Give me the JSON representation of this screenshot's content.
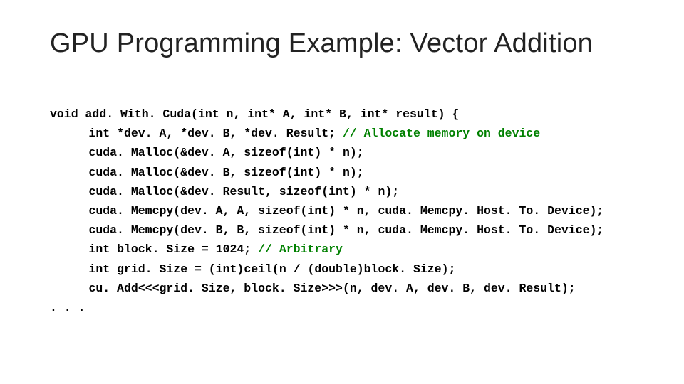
{
  "title": "GPU Programming Example: Vector Addition",
  "code": {
    "l1_a": "void",
    "l1_b": " add. With. Cuda(",
    "l1_c": "int",
    "l1_d": " n, ",
    "l1_e": "int*",
    "l1_f": " A, ",
    "l1_g": "int*",
    "l1_h": " B, ",
    "l1_i": "int*",
    "l1_j": " result) {",
    "l2_a": "int",
    "l2_b": " *dev. A, *dev. B, *dev. Result; ",
    "l2_c": "// Allocate memory on device",
    "l3": "cuda. Malloc(&dev. A, ",
    "l3_b": "sizeof",
    "l3_c": "(",
    "l3_d": "int",
    "l3_e": ") * n);",
    "l4": "cuda. Malloc(&dev. B, ",
    "l4_b": "sizeof",
    "l4_c": "(",
    "l4_d": "int",
    "l4_e": ") * n);",
    "l5": "cuda. Malloc(&dev. Result, ",
    "l5_b": "sizeof",
    "l5_c": "(",
    "l5_d": "int",
    "l5_e": ") * n);",
    "l6": "cuda. Memcpy(dev. A, A, ",
    "l6_b": "sizeof",
    "l6_c": "(",
    "l6_d": "int",
    "l6_e": ") * n, cuda. Memcpy. Host. To. Device);",
    "l7": "cuda. Memcpy(dev. B, B, ",
    "l7_b": "sizeof",
    "l7_c": "(",
    "l7_d": "int",
    "l7_e": ") * n, cuda. Memcpy. Host. To. Device);",
    "l8_a": "int",
    "l8_b": " block. Size = 1024; ",
    "l8_c": "// Arbitrary",
    "l9_a": "int",
    "l9_b": " grid. Size = (",
    "l9_c": "int",
    "l9_d": ")ceil(n / (",
    "l9_e": "double",
    "l9_f": ")block. Size);",
    "l10": "cu. Add<<<grid. Size, block. Size>>>(n, dev. A, dev. B, dev. Result);",
    "l11": ". . ."
  }
}
